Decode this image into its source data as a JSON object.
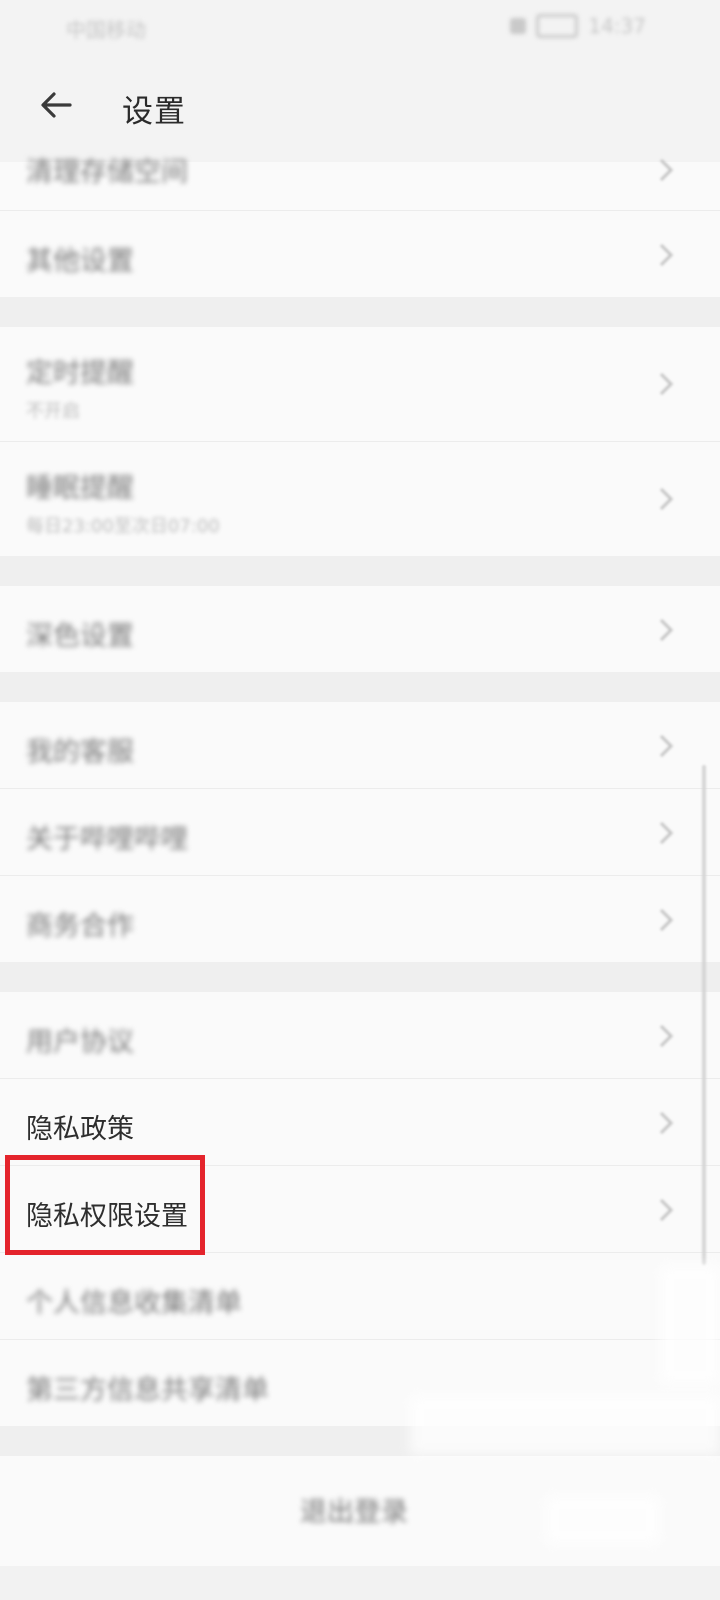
{
  "status_bar": {
    "carrier": "中国移动",
    "time": "14:37"
  },
  "header": {
    "title": "设置"
  },
  "groups": [
    {
      "items": [
        {
          "label": "清理存储空间"
        },
        {
          "label": "其他设置"
        }
      ]
    },
    {
      "items": [
        {
          "label": "定时提醒",
          "sub": "不开启"
        },
        {
          "label": "睡眠提醒",
          "sub": "每日23:00至次日07:00"
        }
      ]
    },
    {
      "items": [
        {
          "label": "深色设置"
        }
      ]
    },
    {
      "items": [
        {
          "label": "我的客服"
        },
        {
          "label": "关于哔哩哔哩"
        },
        {
          "label": "商务合作"
        }
      ]
    },
    {
      "items": [
        {
          "label": "用户协议"
        },
        {
          "label": "隐私政策"
        },
        {
          "label": "隐私权限设置"
        },
        {
          "label": "个人信息收集清单"
        },
        {
          "label": "第三方信息共享清单"
        }
      ]
    }
  ],
  "logout": {
    "label": "退出登录"
  },
  "colors": {
    "highlight": "#e4242c"
  }
}
